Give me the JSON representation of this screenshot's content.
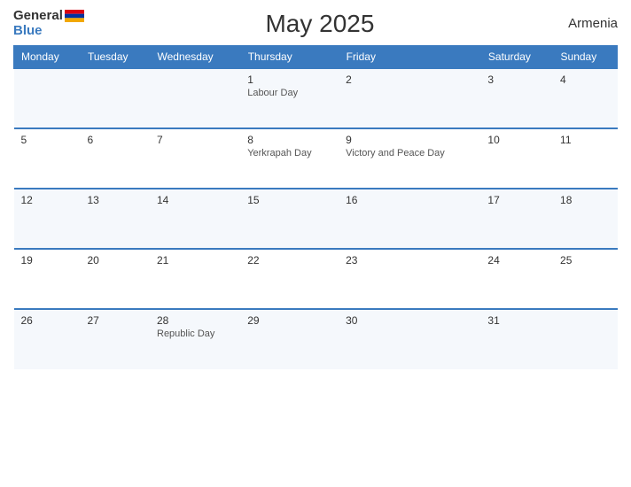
{
  "header": {
    "logo_general": "General",
    "logo_blue": "Blue",
    "title": "May 2025",
    "country": "Armenia"
  },
  "calendar": {
    "columns": [
      "Monday",
      "Tuesday",
      "Wednesday",
      "Thursday",
      "Friday",
      "Saturday",
      "Sunday"
    ],
    "rows": [
      [
        {
          "day": "",
          "holiday": ""
        },
        {
          "day": "",
          "holiday": ""
        },
        {
          "day": "",
          "holiday": ""
        },
        {
          "day": "1",
          "holiday": "Labour Day"
        },
        {
          "day": "2",
          "holiday": ""
        },
        {
          "day": "3",
          "holiday": ""
        },
        {
          "day": "4",
          "holiday": ""
        }
      ],
      [
        {
          "day": "5",
          "holiday": ""
        },
        {
          "day": "6",
          "holiday": ""
        },
        {
          "day": "7",
          "holiday": ""
        },
        {
          "day": "8",
          "holiday": "Yerkrapah Day"
        },
        {
          "day": "9",
          "holiday": "Victory and Peace Day"
        },
        {
          "day": "10",
          "holiday": ""
        },
        {
          "day": "11",
          "holiday": ""
        }
      ],
      [
        {
          "day": "12",
          "holiday": ""
        },
        {
          "day": "13",
          "holiday": ""
        },
        {
          "day": "14",
          "holiday": ""
        },
        {
          "day": "15",
          "holiday": ""
        },
        {
          "day": "16",
          "holiday": ""
        },
        {
          "day": "17",
          "holiday": ""
        },
        {
          "day": "18",
          "holiday": ""
        }
      ],
      [
        {
          "day": "19",
          "holiday": ""
        },
        {
          "day": "20",
          "holiday": ""
        },
        {
          "day": "21",
          "holiday": ""
        },
        {
          "day": "22",
          "holiday": ""
        },
        {
          "day": "23",
          "holiday": ""
        },
        {
          "day": "24",
          "holiday": ""
        },
        {
          "day": "25",
          "holiday": ""
        }
      ],
      [
        {
          "day": "26",
          "holiday": ""
        },
        {
          "day": "27",
          "holiday": ""
        },
        {
          "day": "28",
          "holiday": "Republic Day"
        },
        {
          "day": "29",
          "holiday": ""
        },
        {
          "day": "30",
          "holiday": ""
        },
        {
          "day": "31",
          "holiday": ""
        },
        {
          "day": "",
          "holiday": ""
        }
      ]
    ]
  }
}
